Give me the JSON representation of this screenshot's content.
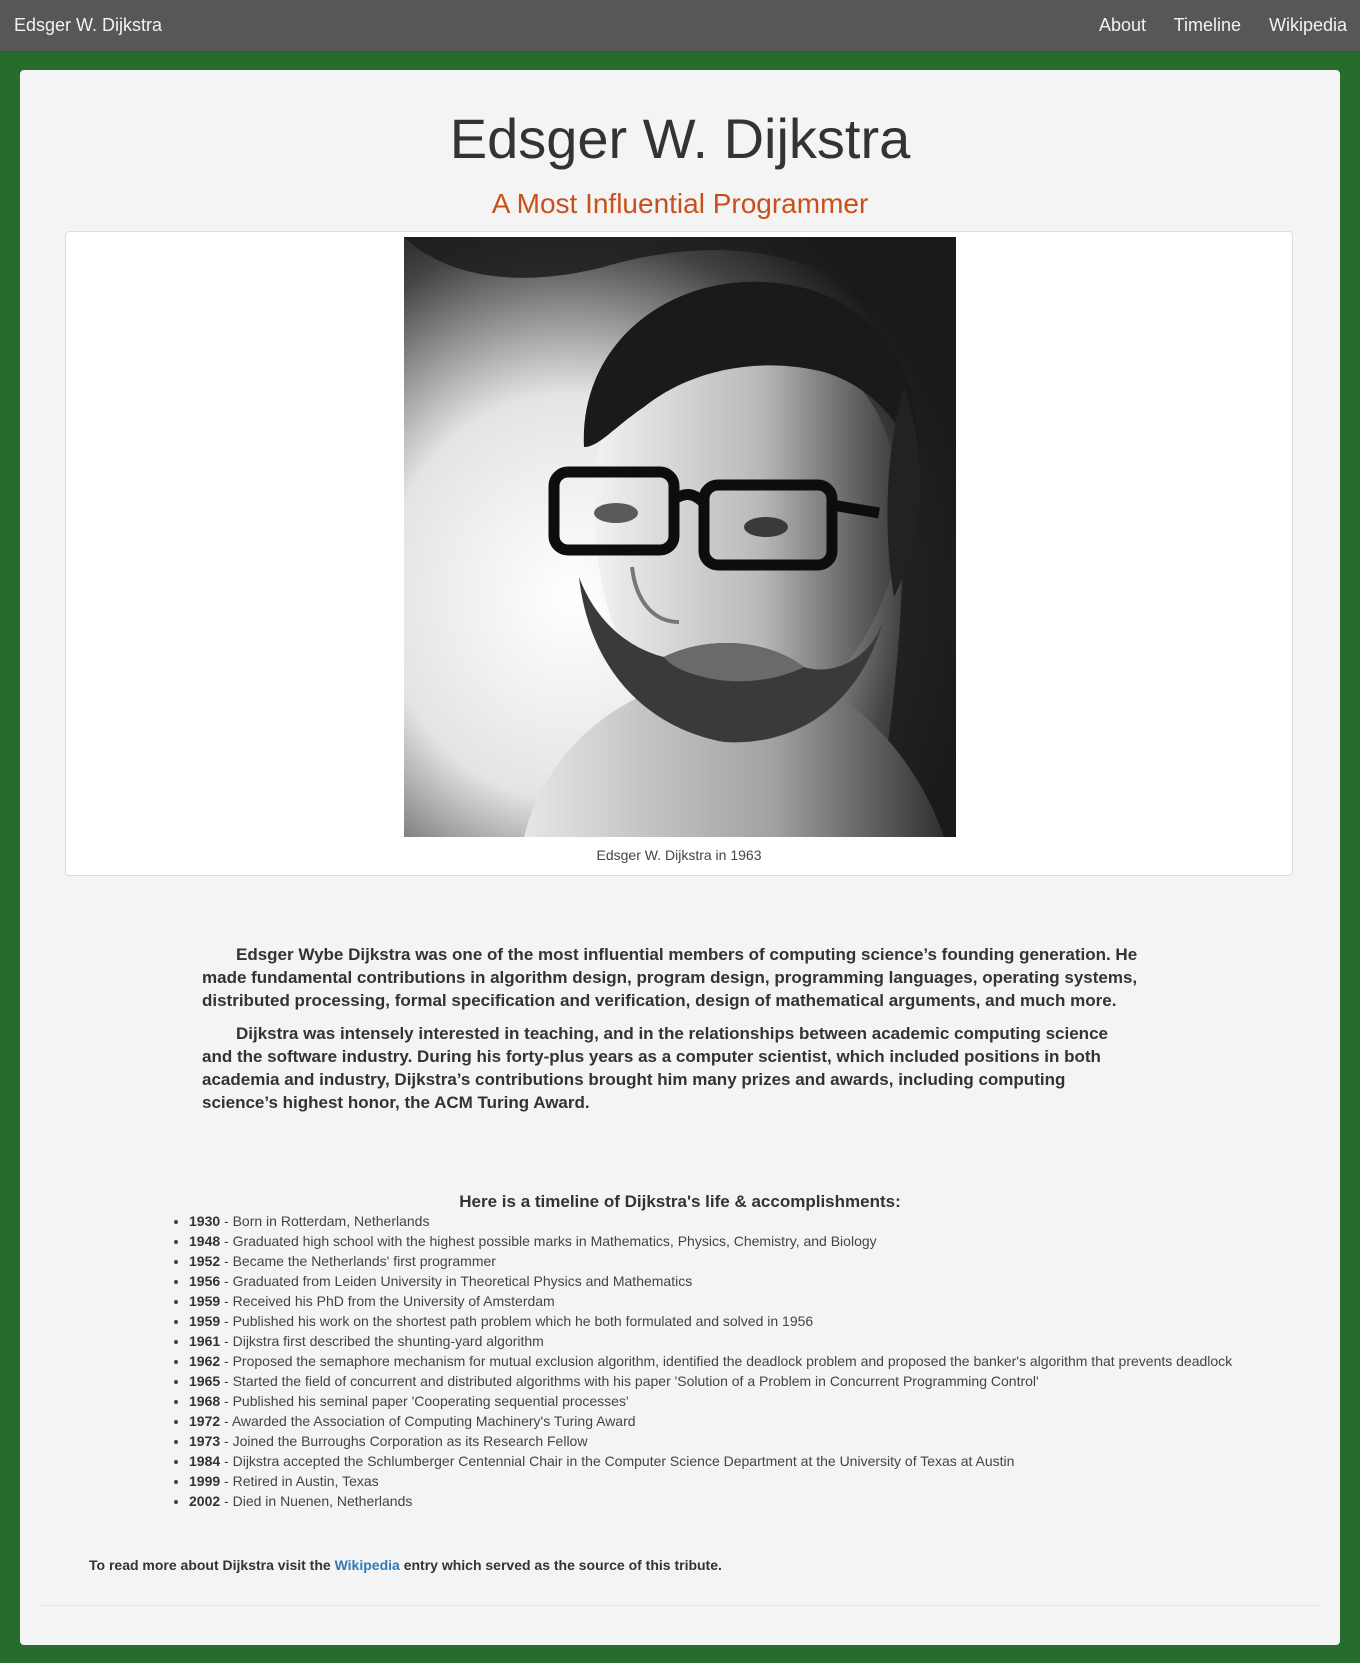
{
  "navbar": {
    "brand": "Edsger W. Dijkstra",
    "links": [
      "About",
      "Timeline",
      "Wikipedia"
    ]
  },
  "header": {
    "title": "Edsger W. Dijkstra",
    "subtitle": "A Most Influential Programmer"
  },
  "figure": {
    "image_description": "black-and-white portrait photograph of a bearded man with dark-rimmed glasses",
    "caption": "Edsger W. Dijkstra in 1963"
  },
  "bio": {
    "paragraphs": [
      "Edsger Wybe Dijkstra was one of the most influential members of computing science’s founding generation. He made fundamental contributions in algorithm design, program design, programming languages, operating systems, distributed processing, formal specification and verification, design of mathematical arguments, and much more.",
      "Dijkstra was intensely interested in teaching, and in the relationships between academic computing science and the software industry. During his forty-plus years as a computer scientist, which included positions in both academia and industry, Dijkstra’s contributions brought him many prizes and awards, including computing science’s highest honor, the ACM Turing Award."
    ]
  },
  "timeline": {
    "heading": "Here is a timeline of Dijkstra's life & accomplishments:",
    "items": [
      {
        "year": "1930",
        "text": " - Born in Rotterdam, Netherlands"
      },
      {
        "year": "1948",
        "text": " - Graduated high school with the highest possible marks in Mathematics, Physics, Chemistry, and Biology"
      },
      {
        "year": "1952",
        "text": " - Became the Netherlands' first programmer"
      },
      {
        "year": "1956",
        "text": " - Graduated from Leiden University in Theoretical Physics and Mathematics"
      },
      {
        "year": "1959",
        "text": " - Received his PhD from the University of Amsterdam"
      },
      {
        "year": "1959",
        "text": " - Published his work on the shortest path problem which he both formulated and solved in 1956"
      },
      {
        "year": "1961",
        "text": " - Dijkstra first described the shunting-yard algorithm"
      },
      {
        "year": "1962",
        "text": " - Proposed the semaphore mechanism for mutual exclusion algorithm, identified the deadlock problem and proposed the banker's algorithm that prevents deadlock"
      },
      {
        "year": "1965",
        "text": " - Started the field of concurrent and distributed algorithms with his paper 'Solution of a Problem in Concurrent Programming Control'"
      },
      {
        "year": "1968",
        "text": " - Published his seminal paper 'Cooperating sequential processes'"
      },
      {
        "year": "1972",
        "text": " - Awarded the Association of Computing Machinery's Turing Award"
      },
      {
        "year": "1973",
        "text": " - Joined the Burroughs Corporation as its Research Fellow"
      },
      {
        "year": "1984",
        "text": " - Dijkstra accepted the Schlumberger Centennial Chair in the Computer Science Department at the University of Texas at Austin"
      },
      {
        "year": "1999",
        "text": " - Retired in Austin, Texas"
      },
      {
        "year": "2002",
        "text": " - Died in Nuenen, Netherlands"
      }
    ]
  },
  "footer": {
    "before_link": "To read more about Dijkstra visit the ",
    "link_text": "Wikipedia",
    "after_link": " entry which served as the source of this tribute."
  },
  "colors": {
    "page_background": "#286c2d",
    "navbar": "#575757",
    "subtitle": "#c9501c",
    "link": "#337ab7"
  }
}
